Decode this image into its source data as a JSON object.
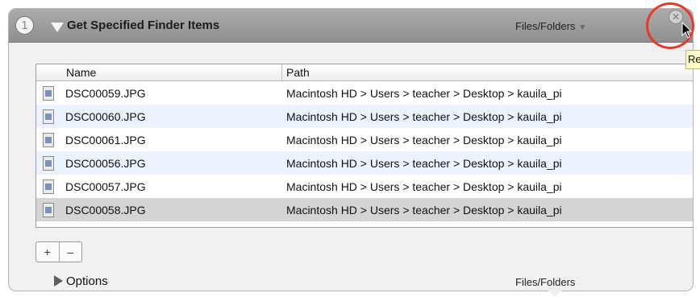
{
  "action": {
    "step_number": "1",
    "title": "Get Specified Finder Items",
    "input_type": "Files/Folders",
    "output_type": "Files/Folders"
  },
  "tooltip": {
    "text": "Re"
  },
  "table": {
    "columns": [
      "Name",
      "Path"
    ],
    "rows": [
      {
        "name": "DSC00059.JPG",
        "path": "Macintosh HD > Users > teacher > Desktop > kauila_pi"
      },
      {
        "name": "DSC00060.JPG",
        "path": "Macintosh HD > Users > teacher > Desktop > kauila_pi"
      },
      {
        "name": "DSC00061.JPG",
        "path": "Macintosh HD > Users > teacher > Desktop > kauila_pi"
      },
      {
        "name": "DSC00056.JPG",
        "path": "Macintosh HD > Users > teacher > Desktop > kauila_pi"
      },
      {
        "name": "DSC00057.JPG",
        "path": "Macintosh HD > Users > teacher > Desktop > kauila_pi"
      },
      {
        "name": "DSC00058.JPG",
        "path": "Macintosh HD > Users > teacher > Desktop > kauila_pi"
      }
    ],
    "selected_row": 5
  },
  "buttons": {
    "add": "+",
    "remove": "–"
  },
  "options": {
    "label": "Options"
  },
  "icons": {
    "close": "close-icon",
    "disclosure": "disclosure-triangle-icon",
    "file": "jpeg-file-icon",
    "cursor": "mouse-pointer-icon"
  },
  "colors": {
    "annotation": "#e53a2a",
    "titlebar": "#9d9d9d",
    "alt_row": "#edf3fe"
  }
}
